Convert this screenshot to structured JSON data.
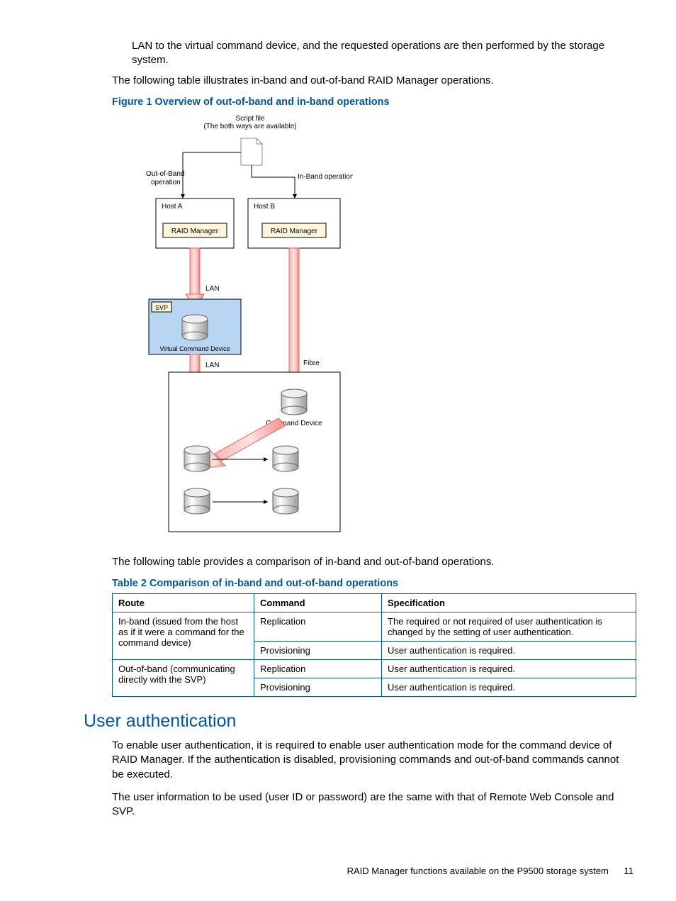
{
  "intro_p1": "LAN to the virtual command device, and the requested operations are then performed by the storage system.",
  "intro_p2": "The following table illustrates in-band and out-of-band RAID Manager operations.",
  "figure_caption": "Figure 1 Overview of out-of-band and in-band operations",
  "diagram": {
    "script_file_1": "Script file",
    "script_file_2": "(The both ways are available)",
    "outband_1": "Out-of-Band",
    "outband_2": "operation",
    "inband": "In-Band operation",
    "host_a": "Host A",
    "host_b": "Host B",
    "raid_mgr": "RAID Manager",
    "lan": "LAN",
    "svp": "SVP",
    "vcd": "Virtual Command Device",
    "fibre": "Fibre",
    "cmddev": "Command Device"
  },
  "compare_p": "The following table provides a comparison of in-band and out-of-band operations.",
  "table_caption": "Table 2 Comparison of in-band and out-of-band operations",
  "table": {
    "headers": {
      "route": "Route",
      "command": "Command",
      "spec": "Specification"
    },
    "inband_route": "In-band (issued from the host as if it were a command for the command device)",
    "outband_route": "Out-of-band (communicating directly with the SVP)",
    "cmd_repl": "Replication",
    "cmd_prov": "Provisioning",
    "spec_inband_repl": "The required or not required of user authentication is changed by the setting of user authentication.",
    "spec_req": "User authentication is required."
  },
  "section_heading": "User authentication",
  "auth_p1": "To enable user authentication, it is required to enable user authentication mode for the command device of RAID Manager. If the authentication is disabled, provisioning commands and out-of-band commands cannot be executed.",
  "auth_p2": "The user information to be used (user ID or password) are the same with that of Remote Web Console and SVP.",
  "footer_text": "RAID Manager functions available on the P9500 storage system",
  "page_number": "11"
}
